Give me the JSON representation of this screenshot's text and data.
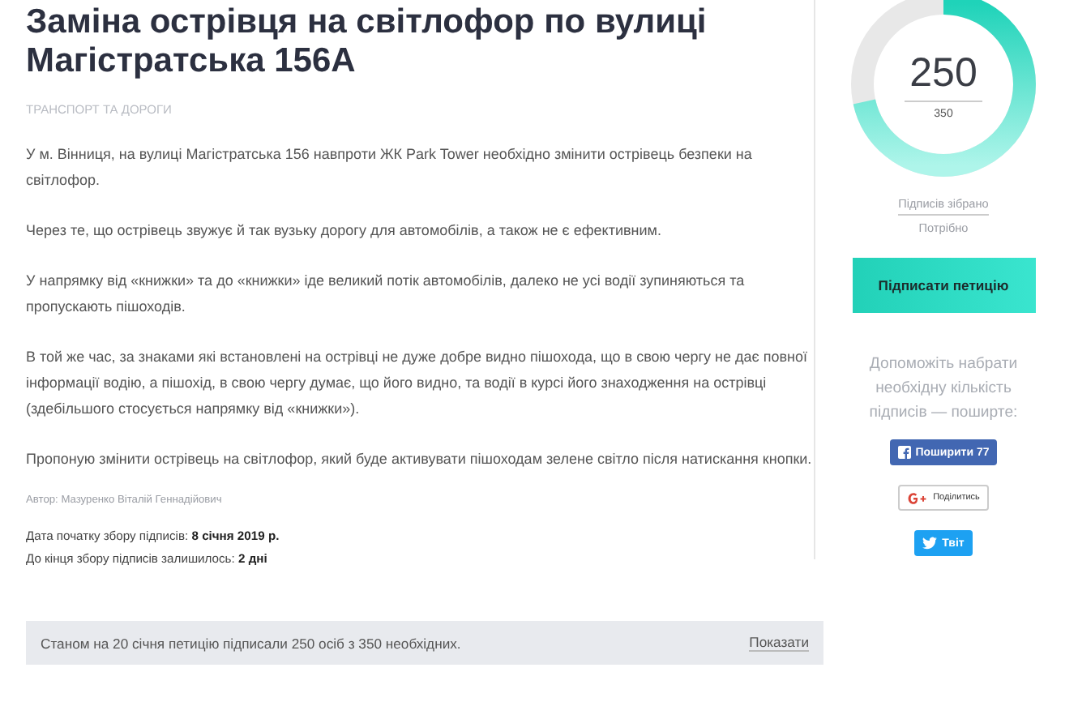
{
  "petition": {
    "title": "Заміна острівця на світлофор по вулиці Магістратська 156А",
    "category": "ТРАНСПОРТ ТА ДОРОГИ",
    "paragraphs": [
      "У м. Вінниця, на вулиці Магістратська 156 навпроти ЖК Park Tower необхідно змінити острівець безпеки на світлофор.",
      "Через те, що острівець звужує й так вузьку дорогу для автомобілів, а також не є ефективним.",
      "У напрямку від «книжки» та до «книжки» іде великий потік автомобілів, далеко не усі водії зупиняються та пропускають пішоходів.",
      "В той же час, за знаками які встановлені на острівці не дуже добре видно пішохода, що в свою чергу не дає повної інформації водію, а пішохід, в свою чергу думає, що його видно, та водії в курсі його знаходження на острівці (здебільшого стосується напрямку від «книжки»).",
      "Пропоную змінити острівець на світлофор, який буде активувати пішоходам зелене світло після натискання кнопки."
    ],
    "author": "Автор: Мазуренко Віталій Геннадійович",
    "dates": [
      "Дата початку збору підписів: **8 січня 2019 р.**",
      "До кінця збору підписів залишилось: **2 дні**"
    ],
    "status": {
      "text": "Станом на 20 січня петицію підписали 250 осіб з 350 необхідних.",
      "link": "Показати"
    }
  },
  "sidebar": {
    "progress": {
      "collected": "250",
      "required": "350"
    },
    "collected_label": "Підписів зібрано",
    "required_label": "Потрібно",
    "sign_button": "Підписати петицію",
    "help_text": "Допоможіть набрати необхідну кількість підписів — поширте:",
    "share": [
      {
        "kind": "facebook",
        "label": "Поширити 77"
      },
      {
        "kind": "google",
        "label": "Поділитись"
      },
      {
        "kind": "twitter",
        "label": "Твіт"
      }
    ]
  }
}
